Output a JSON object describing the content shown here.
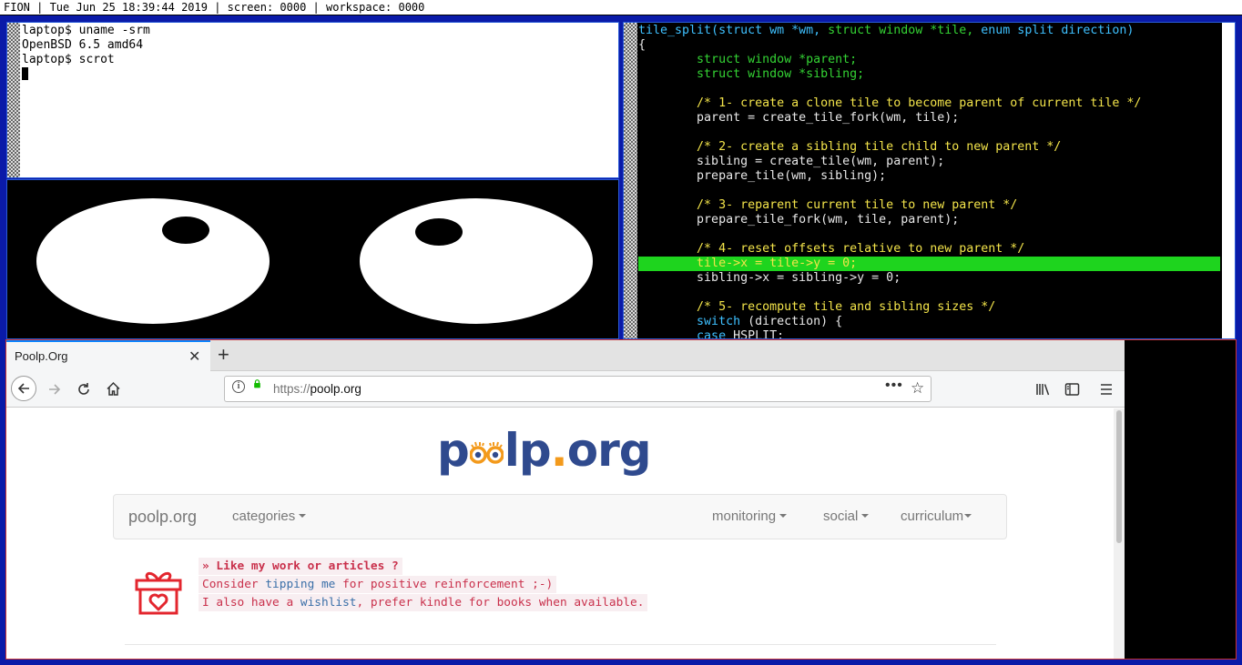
{
  "statusbar": {
    "text": "FION | Tue Jun 25 18:39:44 2019 | screen: 0000 | workspace: 0000"
  },
  "terminal": {
    "lines": [
      "laptop$ uname -srm",
      "OpenBSD 6.5 amd64",
      "laptop$ scrot"
    ]
  },
  "code": {
    "signature": {
      "fn": "tile_split",
      "p1": "(struct wm *wm, ",
      "p2": "struct window *tile, ",
      "p3": "enum split direction)"
    },
    "open_brace": "{",
    "decl1": "struct window *parent;",
    "decl2": "struct window *sibling;",
    "c1": "/* 1- create a clone tile to become parent of current tile */",
    "s1": "parent = create_tile_fork(wm, tile);",
    "c2": "/* 2- create a sibling tile child to new parent */",
    "s2": "sibling = create_tile(wm, parent);",
    "s3": "prepare_tile(wm, sibling);",
    "c3": "/* 3- reparent current tile to new parent */",
    "s4": "prepare_tile_fork(wm, tile, parent);",
    "c4": "/* 4- reset offsets relative to new parent */",
    "s5": "tile->x = tile->y = 0;",
    "s6": "sibling->x = sibling->y = 0;",
    "c5": "/* 5- recompute tile and sibling sizes */",
    "s7_kw": "switch",
    "s7_rest": " (direction) {",
    "s8_kw": "case",
    "s8_rest": " HSPLIT:"
  },
  "browser": {
    "tab_title": "Poolp.Org",
    "tab_close": "✕",
    "new_tab": "+",
    "url_scheme": "https://",
    "url_host": "poolp.org",
    "url_more": "•••",
    "star": "☆",
    "icons": {
      "back": "back-arrow-icon",
      "forward": "forward-arrow-icon",
      "reload": "reload-icon",
      "home": "home-icon",
      "library": "library-icon",
      "sidebar": "sidebar-icon",
      "menu": "hamburger-menu-icon"
    }
  },
  "site": {
    "logo": {
      "p": "p",
      "lp": "lp",
      "dot": ".",
      "org": "org"
    },
    "nav": {
      "brand": "poolp.org",
      "categories": "categories",
      "monitoring": "monitoring",
      "social": "social",
      "curriculum": "curriculum"
    },
    "tip": {
      "heading": "» Like my work or articles ?",
      "l2_pre": "Consider ",
      "l2_link": "tipping me",
      "l2_post": " for positive reinforcement ;-)",
      "l3_pre": "I also have a ",
      "l3_link": "wishlist",
      "l3_post": ", prefer kindle for books when available."
    }
  },
  "colors": {
    "wm_frame": "#0a1aa8",
    "highlight": "#1ed41e",
    "logo_blue": "#2f4a8e",
    "logo_orange": "#f39a1c",
    "tip_red": "#c9304b"
  }
}
